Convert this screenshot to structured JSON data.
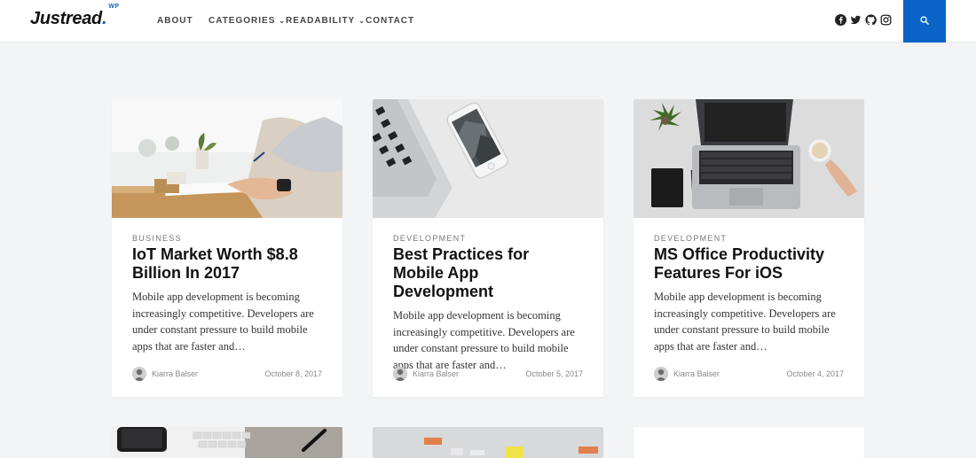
{
  "header": {
    "logo_text": "Justread",
    "logo_dot": ".",
    "logo_sup": "WP",
    "nav": [
      {
        "label": "ABOUT",
        "has_dropdown": false
      },
      {
        "label": "CATEGORIES",
        "has_dropdown": true
      },
      {
        "label": "READABILITY",
        "has_dropdown": true
      },
      {
        "label": "CONTACT",
        "has_dropdown": false
      }
    ],
    "socials": [
      "facebook-icon",
      "twitter-icon",
      "github-icon",
      "instagram-icon"
    ],
    "search_icon": "search-icon",
    "accent": "#0a64c8"
  },
  "posts": [
    {
      "category": "BUSINESS",
      "title": "IoT Market Worth $8.8 Billion In 2017",
      "excerpt": "Mobile app development is becoming increasingly competitive. Developers are under constant pressure to build mobile apps that are faster and…",
      "author": "Kiarra Balser",
      "date": "October 8, 2017"
    },
    {
      "category": "DEVELOPMENT",
      "title": "Best Practices for Mobile App Development",
      "excerpt": "Mobile app development is becoming increasingly competitive. Developers are under constant pressure to build mobile apps that are faster and…",
      "author": "Kiarra Balser",
      "date": "October 5, 2017"
    },
    {
      "category": "DEVELOPMENT",
      "title": "MS Office Productivity Features For iOS",
      "excerpt": "Mobile app development is becoming increasingly competitive. Developers are under constant pressure to build mobile apps that are faster and…",
      "author": "Kiarra Balser",
      "date": "October 4, 2017"
    }
  ]
}
